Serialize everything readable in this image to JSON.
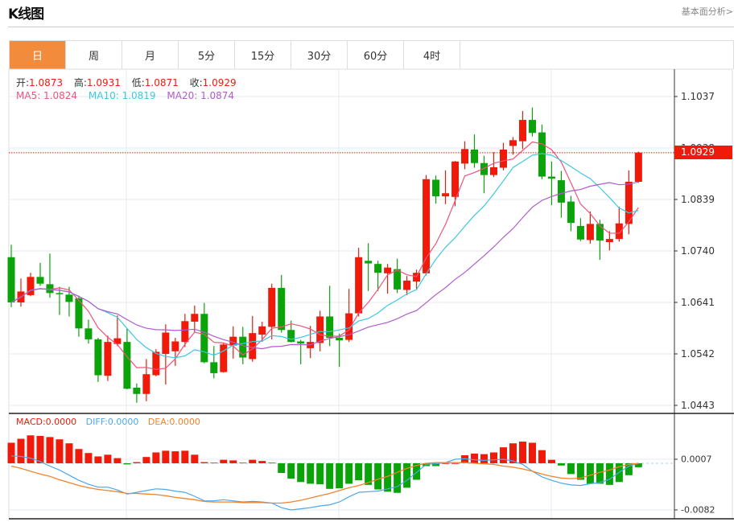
{
  "header": {
    "title": "K线图",
    "link": "基本面分析>"
  },
  "tabs": [
    {
      "label": "日",
      "active": true
    },
    {
      "label": "周"
    },
    {
      "label": "月"
    },
    {
      "label": "5分"
    },
    {
      "label": "15分"
    },
    {
      "label": "30分"
    },
    {
      "label": "60分"
    },
    {
      "label": "4时"
    }
  ],
  "info": {
    "open_label": "开:",
    "open": "1.0873",
    "high_label": "高:",
    "high": "1.0931",
    "low_label": "低:",
    "low": "1.0871",
    "close_label": "收:",
    "close": "1.0929",
    "ma5_label": "MA5: 1.0824",
    "ma10_label": "MA10: 1.0819",
    "ma20_label": "MA20: 1.0874"
  },
  "macd_info": {
    "macd": "MACD:0.0000",
    "diff": "DIFF:0.0000",
    "dea": "DEA:0.0000"
  },
  "colors": {
    "up": "#f01a0a",
    "down": "#0aa30a",
    "ma5": "#f0527a",
    "ma10": "#3cc8e0",
    "ma20": "#b05ccc",
    "diff": "#4aa8f0",
    "dea": "#f5822a",
    "accent": "#f28c3c"
  },
  "chart_data": {
    "type": "candlestick",
    "price_axis": {
      "ticks": [
        "1.1037",
        "1.0938",
        "1.0839",
        "1.0740",
        "1.0641",
        "1.0542",
        "1.0443"
      ],
      "range": [
        1.0443,
        1.1037
      ]
    },
    "current_price": "1.0929",
    "open": [
      1.0728,
      1.0641,
      1.0655,
      1.069,
      1.0676,
      1.0659,
      1.0656,
      1.0649,
      1.0591,
      1.057,
      1.05,
      1.0561,
      1.0565,
      1.0477,
      1.0465,
      1.0501,
      1.0542,
      1.0547,
      1.0565,
      1.0604,
      1.0619,
      1.0526,
      1.0507,
      1.0558,
      1.0575,
      1.0532,
      1.0579,
      1.0594,
      1.0669,
      1.0588,
      1.0566,
      1.0553,
      1.0563,
      1.0614,
      1.0573,
      1.0569,
      1.062,
      1.0721,
      1.0715,
      1.0697,
      1.0705,
      1.0665,
      1.0681,
      1.0697,
      1.0877,
      1.0845,
      1.0844,
      1.0908,
      1.0935,
      1.0909,
      1.0886,
      1.09,
      1.0942,
      1.0951,
      1.0992,
      1.0968,
      1.0883,
      1.0876,
      1.0835,
      1.0788,
      1.0761,
      1.0792,
      1.0757,
      1.0763,
      1.0792,
      1.0873
    ],
    "high": [
      1.0752,
      1.0687,
      1.0698,
      1.0717,
      1.0735,
      1.0671,
      1.0671,
      1.0654,
      1.0608,
      1.0573,
      1.0577,
      1.0616,
      1.0591,
      1.0485,
      1.0532,
      1.0551,
      1.0599,
      1.0573,
      1.0619,
      1.0635,
      1.064,
      1.0557,
      1.0562,
      1.0595,
      1.0594,
      1.0615,
      1.0604,
      1.0677,
      1.0694,
      1.0606,
      1.0569,
      1.0596,
      1.0625,
      1.0673,
      1.0581,
      1.0667,
      1.0746,
      1.0755,
      1.0721,
      1.0715,
      1.0725,
      1.0692,
      1.0704,
      1.0886,
      1.0885,
      1.0895,
      1.0913,
      1.0951,
      1.0964,
      1.0923,
      1.093,
      1.0948,
      1.0959,
      1.1009,
      1.1016,
      1.0983,
      1.0912,
      1.0894,
      1.0846,
      1.0803,
      1.0816,
      1.08,
      1.0778,
      1.0825,
      1.0895,
      1.0931
    ],
    "low": [
      1.0632,
      1.0633,
      1.0653,
      1.0673,
      1.065,
      1.0617,
      1.0614,
      1.0575,
      1.0562,
      1.0488,
      1.049,
      1.0557,
      1.0474,
      1.0448,
      1.0451,
      1.0499,
      1.0483,
      1.0519,
      1.0555,
      1.0583,
      1.0524,
      1.0495,
      1.0506,
      1.0533,
      1.0522,
      1.0527,
      1.0565,
      1.057,
      1.0583,
      1.0564,
      1.0522,
      1.0534,
      1.0547,
      1.0557,
      1.0517,
      1.0565,
      1.0614,
      1.0663,
      1.0663,
      1.0658,
      1.0659,
      1.0655,
      1.0667,
      1.0693,
      1.0831,
      1.083,
      1.0826,
      1.0897,
      1.09,
      1.0851,
      1.0882,
      1.0895,
      1.0925,
      1.0936,
      1.096,
      1.0878,
      1.0828,
      1.0804,
      1.0778,
      1.0759,
      1.0754,
      1.0723,
      1.0741,
      1.0758,
      1.0772,
      1.0871
    ],
    "close": [
      1.0641,
      1.0662,
      1.069,
      1.0677,
      1.0659,
      1.0657,
      1.0642,
      1.0591,
      1.057,
      1.0501,
      1.0565,
      1.0572,
      1.0475,
      1.0465,
      1.0503,
      1.0546,
      1.0583,
      1.0566,
      1.0605,
      1.0619,
      1.0526,
      1.0505,
      1.056,
      1.0575,
      1.0535,
      1.0582,
      1.0595,
      1.0669,
      1.0588,
      1.0565,
      1.0562,
      1.0565,
      1.0614,
      1.0573,
      1.0568,
      1.062,
      1.0728,
      1.0716,
      1.0698,
      1.0708,
      1.0666,
      1.0683,
      1.0698,
      1.0878,
      1.0845,
      1.0851,
      1.0912,
      1.0936,
      1.0909,
      1.0886,
      1.0901,
      1.0935,
      1.0953,
      1.0992,
      1.0967,
      1.0883,
      1.0879,
      1.0833,
      1.0794,
      1.0762,
      1.0792,
      1.076,
      1.0763,
      1.0793,
      1.0873,
      1.0929
    ],
    "macd": {
      "axis_ticks": [
        "0.0007",
        "-0.0082"
      ],
      "range": [
        -0.0082,
        0.0007
      ],
      "hist": [
        0.0036,
        0.0043,
        0.0049,
        0.0048,
        0.0046,
        0.0042,
        0.0035,
        0.0025,
        0.0018,
        0.0012,
        0.0015,
        0.0009,
        -0.0002,
        0.0002,
        0.0011,
        0.0019,
        0.0022,
        0.0021,
        0.0022,
        0.0015,
        0.0002,
        0.0001,
        0.0006,
        0.0005,
        0.0001,
        0.0006,
        0.0004,
        0.0001,
        -0.0017,
        -0.0027,
        -0.0033,
        -0.0036,
        -0.0037,
        -0.0045,
        -0.0044,
        -0.0036,
        -0.003,
        -0.0038,
        -0.0046,
        -0.005,
        -0.0052,
        -0.0043,
        -0.0029,
        -0.0005,
        -0.0005,
        0.0,
        0.0,
        0.0014,
        0.0017,
        0.0016,
        0.0019,
        0.0028,
        0.0035,
        0.0038,
        0.0036,
        0.0023,
        0.0006,
        -0.0004,
        -0.0019,
        -0.0029,
        -0.0036,
        -0.0036,
        -0.0038,
        -0.0033,
        -0.0021,
        -0.0007
      ],
      "diff": [
        0.0013,
        0.0012,
        0.0009,
        0.0003,
        -0.0005,
        -0.0012,
        -0.0021,
        -0.003,
        -0.0037,
        -0.0042,
        -0.0042,
        -0.0047,
        -0.0054,
        -0.0051,
        -0.0048,
        -0.0045,
        -0.0046,
        -0.0049,
        -0.0051,
        -0.0058,
        -0.0066,
        -0.0066,
        -0.0064,
        -0.0066,
        -0.0068,
        -0.0067,
        -0.0068,
        -0.007,
        -0.0078,
        -0.0082,
        -0.008,
        -0.0078,
        -0.0075,
        -0.0073,
        -0.0068,
        -0.0059,
        -0.0051,
        -0.005,
        -0.0049,
        -0.0045,
        -0.0041,
        -0.003,
        -0.0016,
        -0.0002,
        -0.0001,
        0.0001,
        0.0007,
        0.0008,
        0.0006,
        0.0005,
        0.0006,
        0.0007,
        0.0004,
        -0.0002,
        -0.0014,
        -0.0024,
        -0.003,
        -0.0035,
        -0.0038,
        -0.0039,
        -0.0036,
        -0.0034,
        -0.0028,
        -0.0016,
        -0.0005,
        0.0
      ],
      "dea": [
        -0.0005,
        -0.0009,
        -0.0014,
        -0.0019,
        -0.0023,
        -0.0029,
        -0.0034,
        -0.0039,
        -0.0043,
        -0.0046,
        -0.0048,
        -0.005,
        -0.0053,
        -0.0053,
        -0.0054,
        -0.0055,
        -0.0057,
        -0.006,
        -0.0062,
        -0.0064,
        -0.0067,
        -0.0068,
        -0.0068,
        -0.0068,
        -0.0069,
        -0.0069,
        -0.0069,
        -0.007,
        -0.007,
        -0.0068,
        -0.0065,
        -0.0061,
        -0.0057,
        -0.0053,
        -0.0048,
        -0.0043,
        -0.0039,
        -0.0034,
        -0.0028,
        -0.0023,
        -0.0016,
        -0.0009,
        -0.0004,
        0.0,
        0.0001,
        0.0001,
        0.0001,
        0.0001,
        0.0,
        -0.0001,
        -0.0002,
        -0.0005,
        -0.0007,
        -0.001,
        -0.0014,
        -0.0019,
        -0.0023,
        -0.0026,
        -0.0027,
        -0.0026,
        -0.0021,
        -0.0016,
        -0.0012,
        -0.0006,
        -0.0002,
        0.0
      ]
    }
  }
}
